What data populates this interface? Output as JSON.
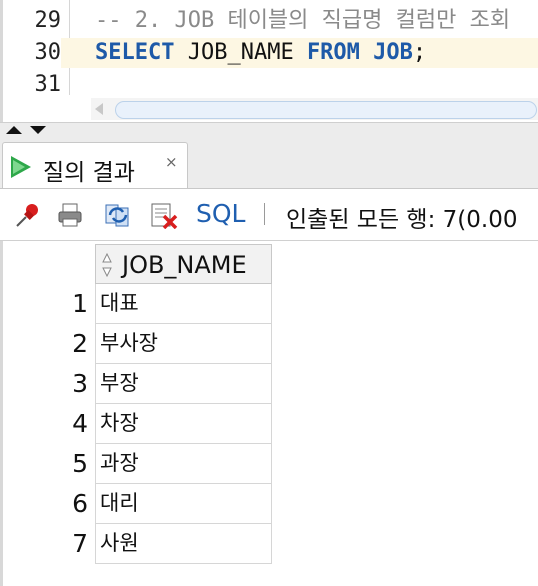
{
  "editor": {
    "lines": [
      {
        "number": "29",
        "segments": [
          {
            "cls": "comment",
            "text": "-- 2. JOB 테이블의 직급명 컬럼만 조회"
          }
        ]
      },
      {
        "number": "30",
        "segments": [
          {
            "cls": "kw",
            "text": "SELECT"
          },
          {
            "cls": "plain",
            "text": " JOB_NAME "
          },
          {
            "cls": "kw",
            "text": "FROM"
          },
          {
            "cls": "plain",
            "text": " "
          },
          {
            "cls": "kw",
            "text": "JOB"
          },
          {
            "cls": "plain",
            "text": ";"
          }
        ]
      },
      {
        "number": "31",
        "segments": []
      }
    ]
  },
  "result_tab": {
    "title": "질의 결과",
    "close": "×"
  },
  "toolbar": {
    "icons": [
      "pin-icon",
      "print-icon",
      "refresh-icon",
      "export-icon"
    ],
    "sql_label": "SQL",
    "separator": "|",
    "status": "인출된 모든 행: 7(0.00"
  },
  "grid": {
    "column": "JOB_NAME",
    "rows": [
      {
        "index": "1",
        "job_name": "대표"
      },
      {
        "index": "2",
        "job_name": "부사장"
      },
      {
        "index": "3",
        "job_name": "부장"
      },
      {
        "index": "4",
        "job_name": "차장"
      },
      {
        "index": "5",
        "job_name": "과장"
      },
      {
        "index": "6",
        "job_name": "대리"
      },
      {
        "index": "7",
        "job_name": "사원"
      }
    ]
  },
  "colors": {
    "keyword": "#1e5aa8",
    "comment": "#8a8a8a",
    "current_line": "#fdf7e3",
    "run_green": "#2ea84a",
    "sql_blue": "#1f5fb0"
  }
}
